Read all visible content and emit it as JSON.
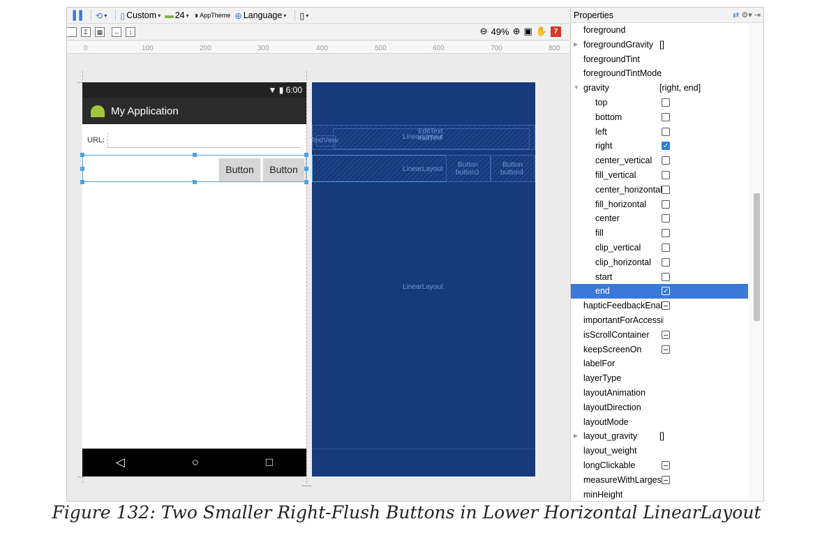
{
  "toolbar": {
    "device_menu": "Custom",
    "api_menu": "24",
    "theme_menu": "AppTheme",
    "language_menu": "Language",
    "zoom": "49%",
    "error_count": "7"
  },
  "ruler": {
    "ticks": [
      "0",
      "100",
      "200",
      "300",
      "400",
      "500",
      "600",
      "700",
      "800"
    ]
  },
  "phone": {
    "time": "6:00",
    "app_title": "My Application",
    "url_label": "URL:",
    "button1": "Button",
    "button2": "Button",
    "nav_back": "◁",
    "nav_home": "○",
    "nav_recent": "□"
  },
  "blueprint": {
    "textview": "TextView",
    "edittext": "EditText",
    "edittext_id": "editText",
    "top_linear": "LinearLayout",
    "row_linear": "LinearLayout",
    "button3": "Button",
    "button3_id": "button3",
    "button4": "Button",
    "button4_id": "button4",
    "root_linear": "LinearLayout"
  },
  "properties": {
    "title": "Properties",
    "rows": [
      {
        "name": "foreground",
        "value": "",
        "type": "text"
      },
      {
        "name": "foregroundGravity",
        "value": "[]",
        "type": "group"
      },
      {
        "name": "foregroundTint",
        "value": "",
        "type": "text"
      },
      {
        "name": "foregroundTintMode",
        "value": "",
        "type": "text"
      },
      {
        "name": "gravity",
        "value": "[right, end]",
        "type": "group-open"
      },
      {
        "name": "top",
        "type": "check",
        "checked": false
      },
      {
        "name": "bottom",
        "type": "check",
        "checked": false
      },
      {
        "name": "left",
        "type": "check",
        "checked": false
      },
      {
        "name": "right",
        "type": "check",
        "checked": true
      },
      {
        "name": "center_vertical",
        "type": "check",
        "checked": false
      },
      {
        "name": "fill_vertical",
        "type": "check",
        "checked": false
      },
      {
        "name": "center_horizontal",
        "type": "check",
        "checked": false
      },
      {
        "name": "fill_horizontal",
        "type": "check",
        "checked": false
      },
      {
        "name": "center",
        "type": "check",
        "checked": false
      },
      {
        "name": "fill",
        "type": "check",
        "checked": false
      },
      {
        "name": "clip_vertical",
        "type": "check",
        "checked": false
      },
      {
        "name": "clip_horizontal",
        "type": "check",
        "checked": false
      },
      {
        "name": "start",
        "type": "check",
        "checked": false
      },
      {
        "name": "end",
        "type": "check",
        "checked": true,
        "selected": true
      },
      {
        "name": "hapticFeedbackEnabled",
        "type": "tri"
      },
      {
        "name": "importantForAccessibility",
        "value": "",
        "type": "text"
      },
      {
        "name": "isScrollContainer",
        "type": "tri"
      },
      {
        "name": "keepScreenOn",
        "type": "tri"
      },
      {
        "name": "labelFor",
        "value": "",
        "type": "text"
      },
      {
        "name": "layerType",
        "value": "",
        "type": "text"
      },
      {
        "name": "layoutAnimation",
        "value": "",
        "type": "text"
      },
      {
        "name": "layoutDirection",
        "value": "",
        "type": "text"
      },
      {
        "name": "layoutMode",
        "value": "",
        "type": "text"
      },
      {
        "name": "layout_gravity",
        "value": "[]",
        "type": "group"
      },
      {
        "name": "layout_weight",
        "value": "",
        "type": "text"
      },
      {
        "name": "longClickable",
        "type": "tri"
      },
      {
        "name": "measureWithLargestChild",
        "type": "tri"
      },
      {
        "name": "minHeight",
        "value": "",
        "type": "text"
      }
    ]
  },
  "caption": "Figure 132: Two Smaller Right-Flush Buttons in Lower Horizontal LinearLayout"
}
